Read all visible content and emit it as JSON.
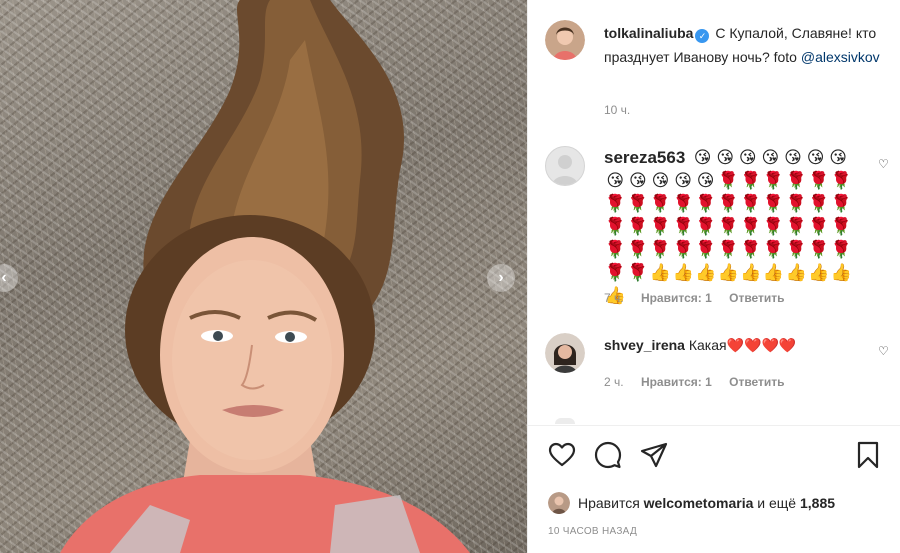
{
  "post": {
    "author": "tolkalinaliuba",
    "verified_icon": "verified-badge-icon",
    "caption": "С Купалой, Славяне! кто празднует Иванову ночь? foto",
    "caption_mention": "@alexsivkov",
    "time": "10 ч."
  },
  "comments": [
    {
      "username": "sereza563",
      "text": "",
      "emoji": [
        "😘",
        "😘",
        "😘",
        "😘",
        "😘",
        "😘",
        "😘",
        "😘",
        "😘",
        "😘",
        "😘",
        "😘",
        "🌹",
        "🌹",
        "🌹",
        "🌹",
        "🌹",
        "🌹",
        "🌹",
        "🌹",
        "🌹",
        "🌹",
        "🌹",
        "🌹",
        "🌹",
        "🌹",
        "🌹",
        "🌹",
        "🌹",
        "🌹",
        "🌹",
        "🌹",
        "🌹",
        "🌹",
        "🌹",
        "🌹",
        "🌹",
        "🌹",
        "🌹",
        "🌹",
        "🌹",
        "🌹",
        "🌹",
        "🌹",
        "🌹",
        "🌹",
        "🌹",
        "🌹",
        "🌹",
        "🌹",
        "🌹",
        "🌹",
        "🌹",
        "👍",
        "👍",
        "👍",
        "👍",
        "👍",
        "👍",
        "👍",
        "👍",
        "👍",
        "👍"
      ],
      "time": "7 ч.",
      "likes": "Нравится: 1",
      "reply": "Ответить"
    },
    {
      "username": "shvey_irena",
      "text": "Какая❤️❤️❤️❤️",
      "time": "2 ч.",
      "likes": "Нравится: 1",
      "reply": "Ответить"
    }
  ],
  "likes_bar": {
    "prefix": "Нравится",
    "user": "welcometomaria",
    "middle": "и ещё",
    "count": "1,885"
  },
  "timestamp": "10 ЧАСОВ НАЗАД",
  "colors": {
    "mention": "#00376b",
    "meta": "#8e8e8e",
    "heart": "#ed4956",
    "verified": "#3897f0"
  }
}
